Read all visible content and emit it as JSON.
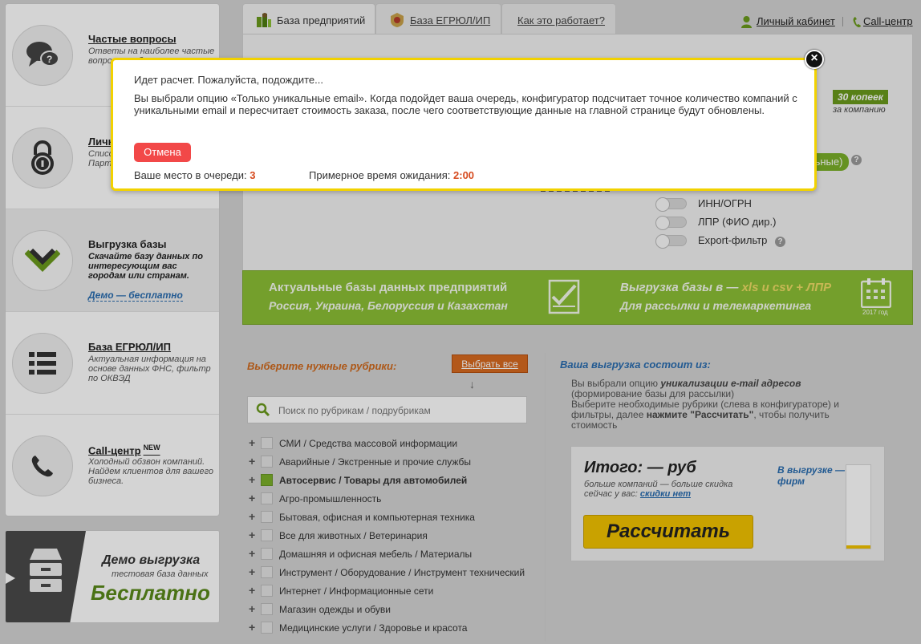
{
  "sidebar": {
    "items": [
      {
        "title": "Частые вопросы",
        "desc": "Ответы на наиболее частые вопросы по базе",
        "icon": "chat-question-icon"
      },
      {
        "title": "Личный кабинет",
        "desc": "Список заказов. Обновления. Партнерская программа",
        "icon": "lock-icon"
      },
      {
        "title": "Выгрузка базы",
        "desc": "Скачайте базу данных по интересующим вас городам или странам.",
        "link": "Демо — бесплатно",
        "icon": "download-chevron-icon"
      },
      {
        "title": "База ЕГРЮЛ/ИП",
        "desc": "Актуальная информация на основе данных ФНС, фильтр по ОКВЭД",
        "icon": "list-icon"
      },
      {
        "title": "Call-центр",
        "badge": "NEW",
        "desc": "Холодный обзвон компаний. Найдем клиентов для вашего бизнеса.",
        "icon": "phone-icon"
      }
    ]
  },
  "demo": {
    "title": "Демо выгрузка",
    "subtitle": "тестовая база данных",
    "free": "Бесплатно"
  },
  "tabs": [
    {
      "label": "База предприятий",
      "icon": "database-icon"
    },
    {
      "label": "База ЕГРЮЛ/ИП",
      "icon": "emblem-icon"
    },
    {
      "label": "Как это работает?"
    }
  ],
  "header": {
    "account": "Личный кабинет",
    "callcenter": "Call-центр"
  },
  "config": {
    "price_badge": "30 копеек",
    "price_note": "за компанию",
    "pill_fragment": "льные)",
    "options": [
      "ИНН/ОГРН",
      "ЛПР (ФИО дир.)",
      "Export-фильтр"
    ]
  },
  "banner": {
    "line1": "Актуальные базы данных предприятий",
    "line2": "Россия, Украина, Белоруссия и Казахстан",
    "line3a": "Выгрузка базы в — ",
    "line3b": "xls и csv + ЛПР",
    "line4": "Для рассылки и телемаркетинга",
    "year": "2017 год"
  },
  "rubrics": {
    "title": "Выберите нужные рубрики:",
    "select_all": "Выбрать все",
    "search_placeholder": "Поиск по рубрикам / подрубрикам",
    "items": [
      {
        "label": "СМИ / Средства массовой информации",
        "checked": false
      },
      {
        "label": "Аварийные / Экстренные и прочие службы",
        "checked": false
      },
      {
        "label": "Автосервис / Товары для автомобилей",
        "checked": true
      },
      {
        "label": "Агро-промышленность",
        "checked": false
      },
      {
        "label": "Бытовая, офисная и компьютерная техника",
        "checked": false
      },
      {
        "label": "Все для животных / Ветеринария",
        "checked": false
      },
      {
        "label": "Домашняя и офисная мебель / Материалы",
        "checked": false
      },
      {
        "label": "Инструмент / Оборудование / Инструмент технический",
        "checked": false
      },
      {
        "label": "Интернет / Информационные сети",
        "checked": false
      },
      {
        "label": "Магазин одежды и обуви",
        "checked": false
      },
      {
        "label": "Медицинские услуги / Здоровье и красота",
        "checked": false
      }
    ]
  },
  "result": {
    "title": "Ваша выгрузка состоит из:",
    "t1": "Вы выбрали опцию ",
    "t1b": "уникализации e-mail адресов",
    "t2": "(формирование базы для рассылки)",
    "t3": "Выберите необходимые рубрики (слева в конфигураторе) и фильтры, далее ",
    "t3b": "нажмите \"Рассчитать\"",
    "t3c": ", чтобы получить стоимость",
    "total": "Итого: — руб",
    "more": "больше компаний — больше скидка",
    "discount_label": "сейчас у вас: ",
    "discount_value": "скидки нет",
    "calc_button": "Рассчитать",
    "in_export": "В выгрузке — фирм"
  },
  "modal": {
    "status": "Идет расчет. Пожалуйста, подождите...",
    "text": "Вы выбрали опцию «Только уникальные email». Когда подойдет ваша очередь, конфигуратор подсчитает точное количество компаний с уникальными email и пересчитает стоимость заказа, после чего соответствующие данные на главной странице будут обновлены.",
    "cancel": "Отмена",
    "queue_label": "Ваше место в очереди: ",
    "queue_value": "3",
    "wait_label": "Примерное время ожидания: ",
    "wait_value": "2:00",
    "close_glyph": "×"
  }
}
